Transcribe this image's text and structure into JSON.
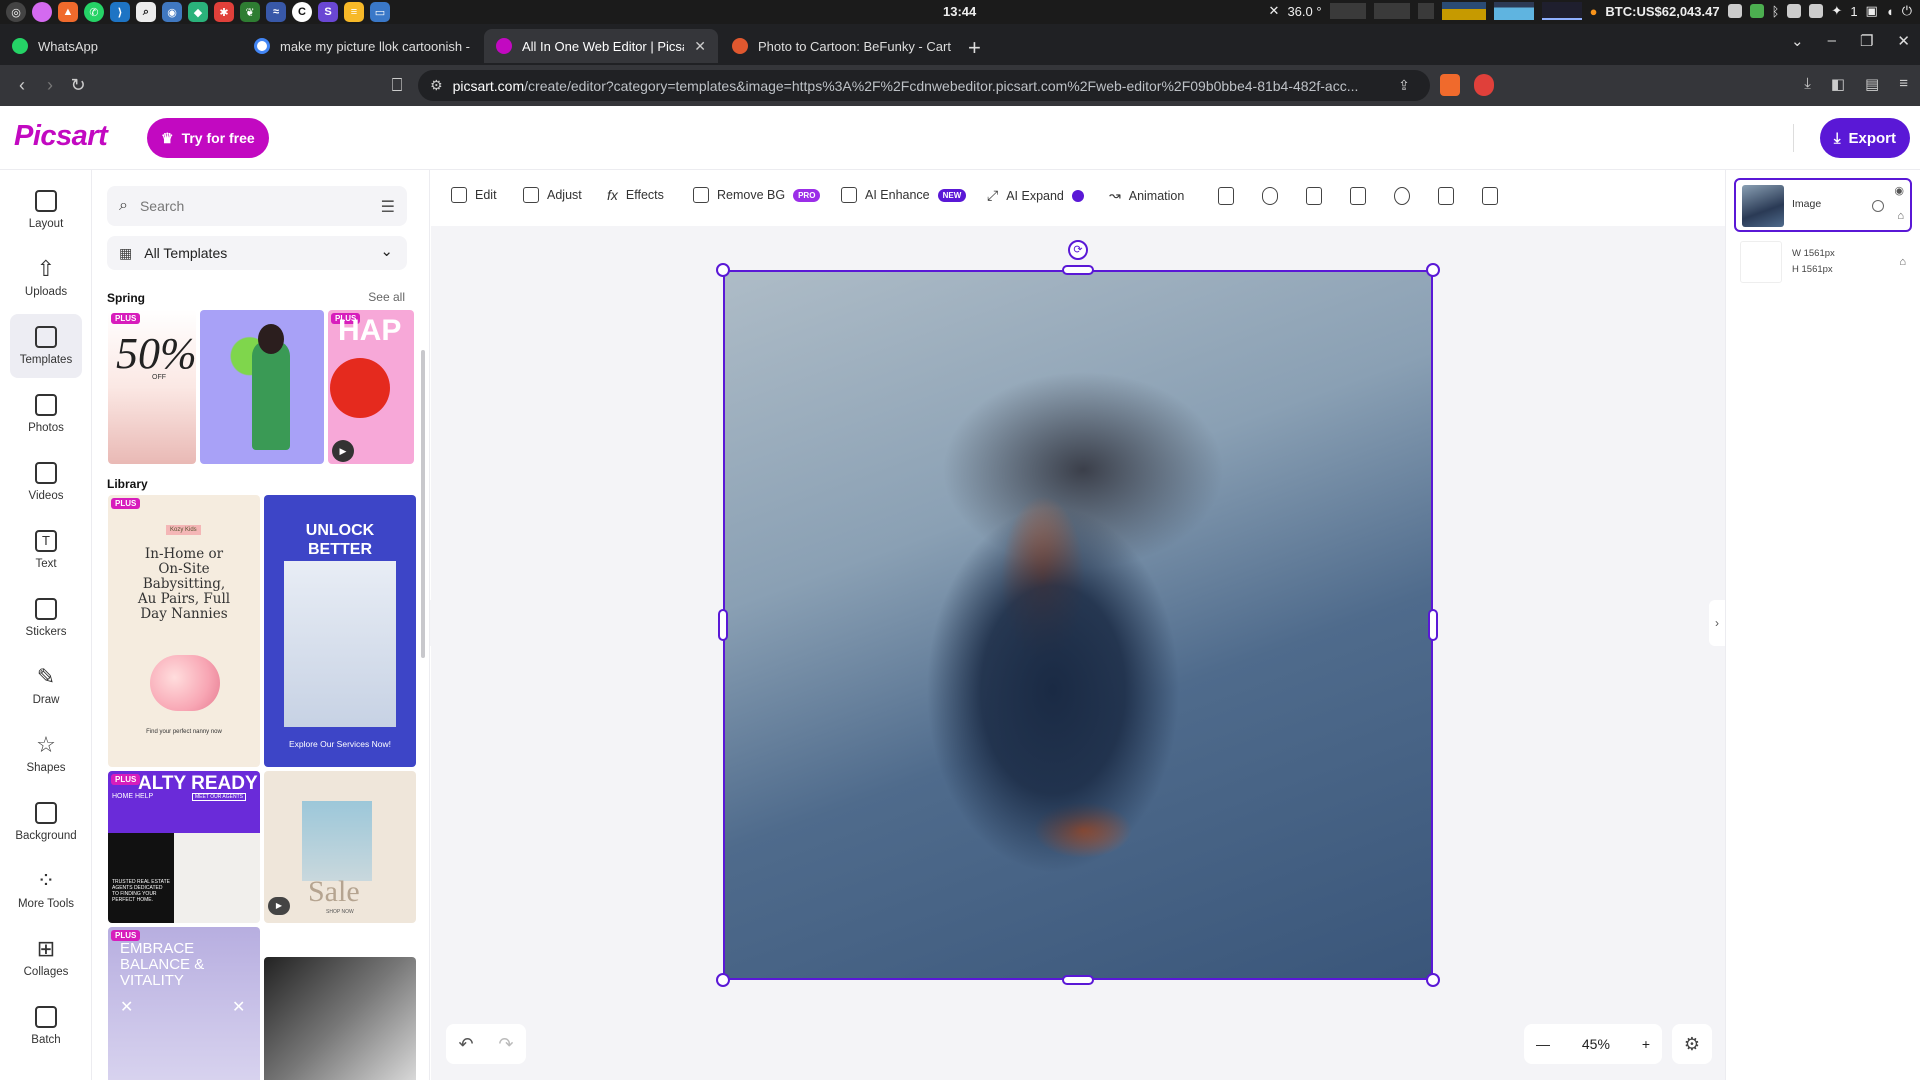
{
  "os": {
    "clock": "13:44",
    "temperature": "36.0 °",
    "btc": "BTC:US$62,043.47",
    "tray_count": "1"
  },
  "browser": {
    "tabs": [
      {
        "label": "WhatsApp",
        "color": "#25d366"
      },
      {
        "label": "make my picture llok cartoonish -",
        "color": "#4285f4"
      },
      {
        "label": "All In One Web Editor | Picsart",
        "color": "#c209c1",
        "active": true
      },
      {
        "label": "Photo to Cartoon: BeFunky - Cart",
        "color": "#e0582f"
      }
    ],
    "url_domain": "picsart.com",
    "url_path": "/create/editor?category=templates&image=https%3A%2F%2Fcdnwebeditor.picsart.com%2Fweb-editor%2F09b0bbe4-81b4-482f-acc..."
  },
  "app": {
    "logo": "Picsart",
    "try_label": "Try for free",
    "export_label": "Export"
  },
  "rail": [
    {
      "label": "Layout",
      "icon": "layout-icon"
    },
    {
      "label": "Uploads",
      "icon": "upload-icon"
    },
    {
      "label": "Templates",
      "icon": "templates-icon",
      "active": true
    },
    {
      "label": "Photos",
      "icon": "photos-icon"
    },
    {
      "label": "Videos",
      "icon": "videos-icon"
    },
    {
      "label": "Text",
      "icon": "text-icon"
    },
    {
      "label": "Stickers",
      "icon": "stickers-icon"
    },
    {
      "label": "Draw",
      "icon": "draw-icon"
    },
    {
      "label": "Shapes",
      "icon": "shapes-icon"
    },
    {
      "label": "Background",
      "icon": "background-icon"
    },
    {
      "label": "More Tools",
      "icon": "more-tools-icon"
    },
    {
      "label": "Collages",
      "icon": "collages-icon"
    },
    {
      "label": "Batch",
      "icon": "batch-icon"
    }
  ],
  "panel": {
    "search_placeholder": "Search",
    "category": "All Templates",
    "spring_title": "Spring",
    "see_all": "See all",
    "library_title": "Library",
    "plus": "PLUS",
    "t1_text": "50%",
    "t1_sub": "OFF",
    "t3_text": "HAP",
    "lib1_tag": "Kozy Kids",
    "lib1_text": "In-Home or On-Site Babysitting, Au Pairs, Full Day Nannies",
    "lib1_foot": "Find your perfect nanny now",
    "lib2_title": "UNLOCK BETTER HEALTH",
    "lib2_foot": "Explore Our Services Now!",
    "lib3_title": "ALTY READY",
    "lib3_sub": "HOME HELP",
    "lib3_btn": "MEET OUR AGENTS",
    "lib3_small": "TRUSTED REAL ESTATE AGENTS DEDICATED TO FINDING YOUR PERFECT HOME.",
    "lib4_text": "Sale",
    "lib4_sub": "SHOP NOW",
    "lib5_text": "EMBRACE BALANCE & VITALITY"
  },
  "toolbar": {
    "edit": "Edit",
    "adjust": "Adjust",
    "effects": "Effects",
    "remove_bg": "Remove BG",
    "pro": "PRO",
    "ai_enhance": "AI Enhance",
    "new": "NEW",
    "ai_expand": "AI Expand",
    "animation": "Animation"
  },
  "canvas": {
    "zoom": "45%"
  },
  "layers": {
    "image_label": "Image",
    "width": "W  1561px",
    "height": "H  1561px"
  }
}
